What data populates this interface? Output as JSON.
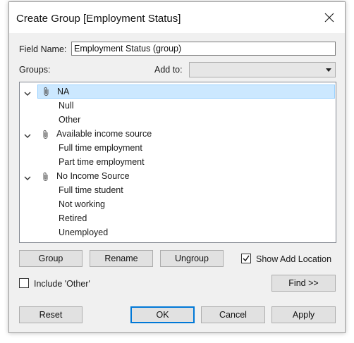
{
  "dialog": {
    "title": "Create Group [Employment Status]",
    "field_name_label": "Field Name:",
    "field_name_value": "Employment Status (group)",
    "groups_label": "Groups:",
    "add_to_label": "Add to:",
    "add_to_value": ""
  },
  "tree": [
    {
      "label": "NA",
      "children": [
        "Null",
        "Other"
      ],
      "selected": true
    },
    {
      "label": "Available income source",
      "children": [
        "Full time employment",
        "Part time employment"
      ]
    },
    {
      "label": "No Income Source",
      "children": [
        "Full time student",
        "Not working",
        "Retired",
        "Unemployed"
      ]
    }
  ],
  "buttons": {
    "group": "Group",
    "rename": "Rename",
    "ungroup": "Ungroup",
    "find": "Find >>",
    "reset": "Reset",
    "ok": "OK",
    "cancel": "Cancel",
    "apply": "Apply"
  },
  "checks": {
    "show_add_location_label": "Show Add Location",
    "show_add_location_checked": true,
    "include_other_label": "Include 'Other'",
    "include_other_checked": false
  },
  "colors": {
    "selection": "#cce8ff",
    "selection_border": "#99d1ff",
    "default_button_border": "#0078d7"
  },
  "icons": {
    "group_icon": "paperclip-icon",
    "expand_icon": "chevron-down-icon",
    "close_icon": "close-icon"
  }
}
